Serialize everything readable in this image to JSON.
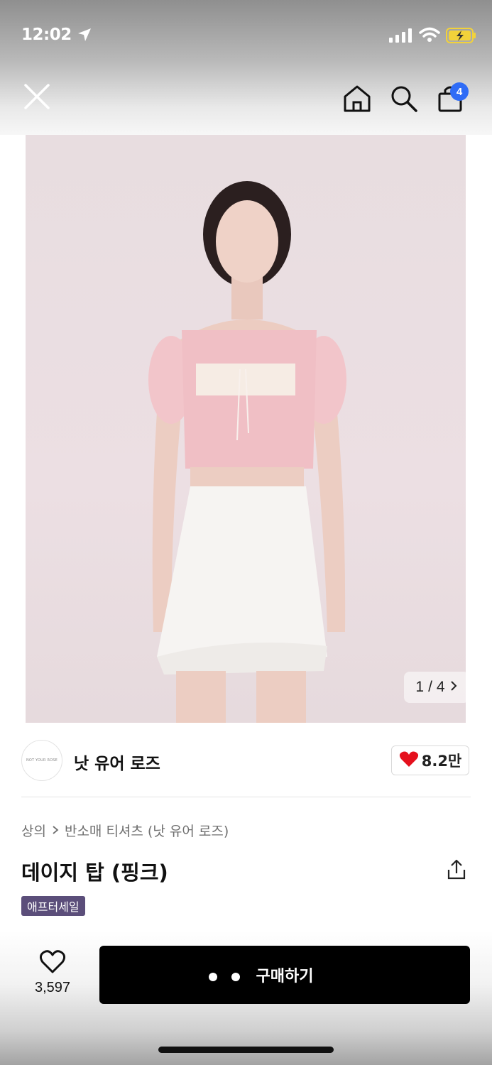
{
  "status_bar": {
    "time": "12:02",
    "icons": [
      "location-arrow-icon",
      "signal-icon",
      "wifi-icon",
      "battery-charging-icon"
    ]
  },
  "nav": {
    "close_icon": "close-icon",
    "home_icon": "home-icon",
    "search_icon": "search-icon",
    "bag_icon": "shopping-bag-icon",
    "cart_count": "4"
  },
  "product_image": {
    "current_page": "1",
    "separator": "/",
    "total_pages": "4",
    "next_icon": "chevron-right-icon"
  },
  "brand": {
    "name": "낫 유어 로즈",
    "logo_text": "NOT YOUR ROSE",
    "likes": "8.2만",
    "heart_color": "#e5101d"
  },
  "breadcrumb": {
    "category": "상의",
    "subcategory": "반소매 티셔츠 (낫 유어 로즈)"
  },
  "product": {
    "title": "데이지 탑 (핑크)",
    "badge": "애프터세일",
    "badge_color": "#5b4e7a"
  },
  "bottom_bar": {
    "wishlist_count": "3,597",
    "buy_label": "구매하기",
    "buy_color": "#000000"
  }
}
